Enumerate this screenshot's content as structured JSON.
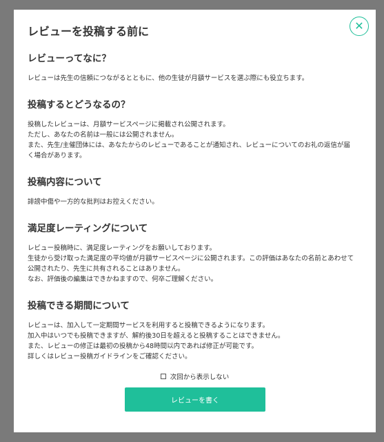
{
  "modal": {
    "title": "レビューを投稿する前に",
    "close_icon": "close-icon",
    "accent": "#1fbf9a"
  },
  "sections": [
    {
      "heading": "レビューってなに？",
      "lines": [
        "レビューは先生の信頼につながるとともに、他の生徒が月額サービスを選ぶ際にも役立ちます。"
      ]
    },
    {
      "heading": "投稿するとどうなるの？",
      "lines": [
        "投稿したレビューは、月額サービスページに掲載され公開されます。",
        "ただし、あなたの名前は一般には公開されません。",
        "また、先生/主催団体には、あなたからのレビューであることが通知され、レビューについてのお礼の返信が届",
        "く場合があります。"
      ]
    },
    {
      "heading": "投稿内容について",
      "lines": [
        "誹謗中傷や一方的な批判はお控えください。"
      ]
    },
    {
      "heading": "満足度レーティングについて",
      "lines": [
        "レビュー投稿時に、満足度レーティングをお願いしております。",
        "生徒から受け取った満足度の平均値が月額サービスページに公開されます。この評価はあなたの名前とあわせて",
        "公開されたり、先生に共有されることはありません。",
        "なお、評価後の編集はできかねますので、何卒ご理解ください。"
      ]
    },
    {
      "heading": "投稿できる期間について",
      "lines": [
        "レビューは、加入して一定期間サービスを利用すると投稿できるようになります。",
        "加入中はいつでも投稿できますが、解約後30日を超えると投稿することはできません。",
        "また、レビューの修正は最初の投稿から48時間以内であれば修正が可能です。",
        "詳しくはレビュー投稿ガイドラインをご確認ください。"
      ]
    }
  ],
  "footer": {
    "checkbox_label": "次回から表示しない",
    "checkbox_checked": false,
    "button_label": "レビューを書く"
  }
}
